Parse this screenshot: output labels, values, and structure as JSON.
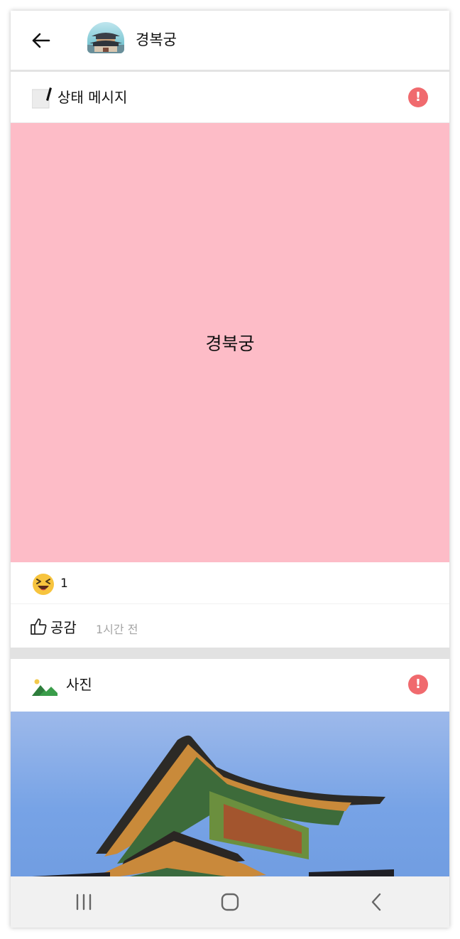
{
  "header": {
    "title": "경복궁",
    "back_icon": "arrow-left-icon",
    "avatar_icon": "palace-avatar"
  },
  "posts": [
    {
      "type_label": "상태 메시지",
      "type_icon": "memo-pen-icon",
      "report_icon": "exclamation-icon",
      "report_symbol": "!",
      "status_text": "경북궁",
      "status_bg": "#fdbcc7",
      "reaction_icon": "laughing-emoji-icon",
      "reaction_count": "1",
      "like_icon": "thumbs-up-outline-icon",
      "like_label": "공감",
      "time": "1시간 전"
    },
    {
      "type_label": "사진",
      "type_icon": "picture-icon",
      "report_icon": "exclamation-icon",
      "report_symbol": "!",
      "photo": "gyeongbokgung-palace-roof-photo"
    }
  ],
  "colors": {
    "report": "#f06a6e",
    "time_text": "#a5a5a5",
    "page_bg": "#e2e2e2"
  },
  "system_nav": {
    "recent_icon": "recent-apps-icon",
    "home_icon": "home-icon",
    "back_icon": "back-chevron-icon"
  }
}
